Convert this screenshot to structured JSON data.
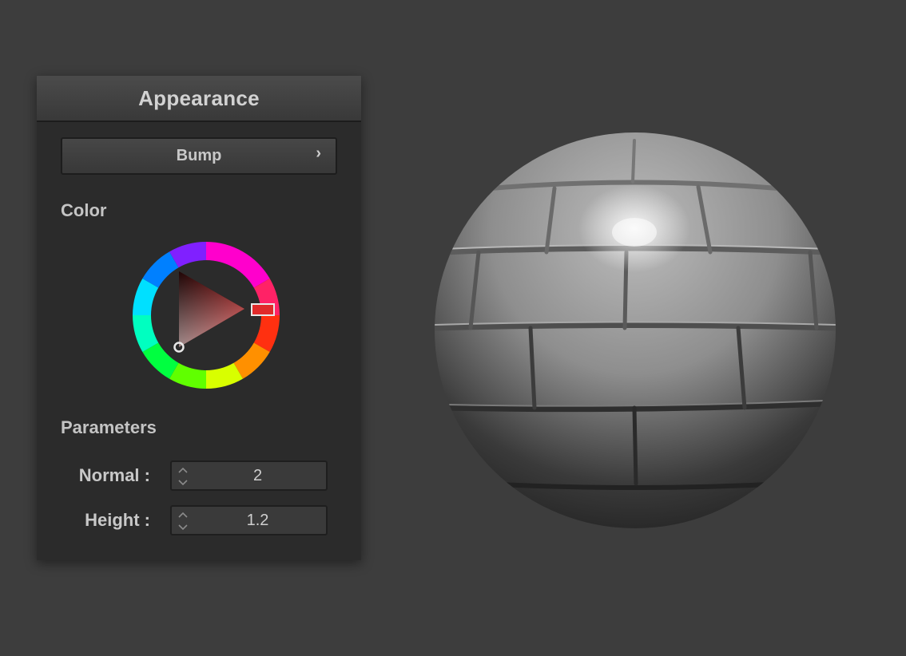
{
  "panel": {
    "title": "Appearance",
    "bump_button": {
      "label": "Bump",
      "chevron": "›"
    },
    "color_section": {
      "label": "Color"
    },
    "color_picker": {
      "hue_hex": "#e02020",
      "hue_name": "red"
    },
    "parameters_section": {
      "label": "Parameters"
    },
    "parameters": [
      {
        "label": "Normal :",
        "value": "2"
      },
      {
        "label": "Height :",
        "value": "1.2"
      }
    ]
  },
  "preview": {
    "icon": "material-preview-sphere"
  }
}
